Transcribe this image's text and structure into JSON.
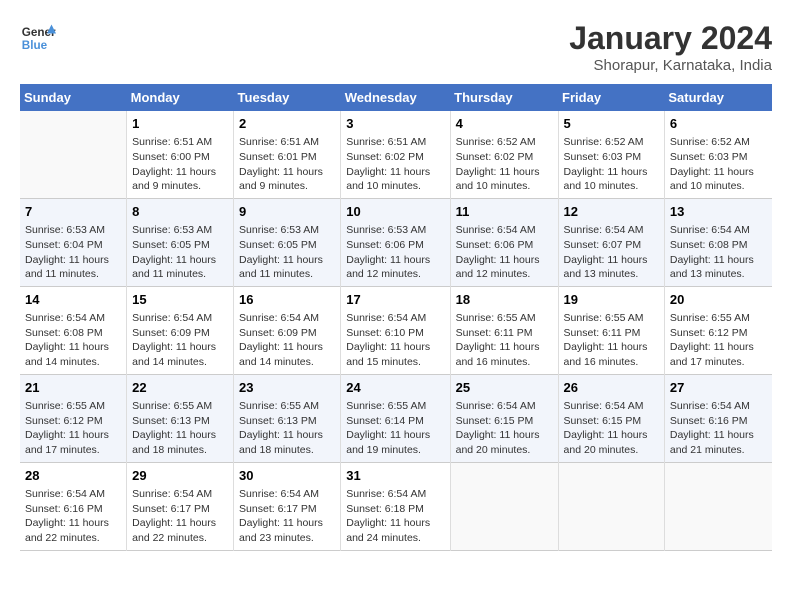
{
  "header": {
    "logo_general": "General",
    "logo_blue": "Blue",
    "month": "January 2024",
    "location": "Shorapur, Karnataka, India"
  },
  "days_of_week": [
    "Sunday",
    "Monday",
    "Tuesday",
    "Wednesday",
    "Thursday",
    "Friday",
    "Saturday"
  ],
  "weeks": [
    [
      {
        "day": "",
        "info": ""
      },
      {
        "day": "1",
        "info": "Sunrise: 6:51 AM\nSunset: 6:00 PM\nDaylight: 11 hours\nand 9 minutes."
      },
      {
        "day": "2",
        "info": "Sunrise: 6:51 AM\nSunset: 6:01 PM\nDaylight: 11 hours\nand 9 minutes."
      },
      {
        "day": "3",
        "info": "Sunrise: 6:51 AM\nSunset: 6:02 PM\nDaylight: 11 hours\nand 10 minutes."
      },
      {
        "day": "4",
        "info": "Sunrise: 6:52 AM\nSunset: 6:02 PM\nDaylight: 11 hours\nand 10 minutes."
      },
      {
        "day": "5",
        "info": "Sunrise: 6:52 AM\nSunset: 6:03 PM\nDaylight: 11 hours\nand 10 minutes."
      },
      {
        "day": "6",
        "info": "Sunrise: 6:52 AM\nSunset: 6:03 PM\nDaylight: 11 hours\nand 10 minutes."
      }
    ],
    [
      {
        "day": "7",
        "info": "Sunrise: 6:53 AM\nSunset: 6:04 PM\nDaylight: 11 hours\nand 11 minutes."
      },
      {
        "day": "8",
        "info": "Sunrise: 6:53 AM\nSunset: 6:05 PM\nDaylight: 11 hours\nand 11 minutes."
      },
      {
        "day": "9",
        "info": "Sunrise: 6:53 AM\nSunset: 6:05 PM\nDaylight: 11 hours\nand 11 minutes."
      },
      {
        "day": "10",
        "info": "Sunrise: 6:53 AM\nSunset: 6:06 PM\nDaylight: 11 hours\nand 12 minutes."
      },
      {
        "day": "11",
        "info": "Sunrise: 6:54 AM\nSunset: 6:06 PM\nDaylight: 11 hours\nand 12 minutes."
      },
      {
        "day": "12",
        "info": "Sunrise: 6:54 AM\nSunset: 6:07 PM\nDaylight: 11 hours\nand 13 minutes."
      },
      {
        "day": "13",
        "info": "Sunrise: 6:54 AM\nSunset: 6:08 PM\nDaylight: 11 hours\nand 13 minutes."
      }
    ],
    [
      {
        "day": "14",
        "info": "Sunrise: 6:54 AM\nSunset: 6:08 PM\nDaylight: 11 hours\nand 14 minutes."
      },
      {
        "day": "15",
        "info": "Sunrise: 6:54 AM\nSunset: 6:09 PM\nDaylight: 11 hours\nand 14 minutes."
      },
      {
        "day": "16",
        "info": "Sunrise: 6:54 AM\nSunset: 6:09 PM\nDaylight: 11 hours\nand 14 minutes."
      },
      {
        "day": "17",
        "info": "Sunrise: 6:54 AM\nSunset: 6:10 PM\nDaylight: 11 hours\nand 15 minutes."
      },
      {
        "day": "18",
        "info": "Sunrise: 6:55 AM\nSunset: 6:11 PM\nDaylight: 11 hours\nand 16 minutes."
      },
      {
        "day": "19",
        "info": "Sunrise: 6:55 AM\nSunset: 6:11 PM\nDaylight: 11 hours\nand 16 minutes."
      },
      {
        "day": "20",
        "info": "Sunrise: 6:55 AM\nSunset: 6:12 PM\nDaylight: 11 hours\nand 17 minutes."
      }
    ],
    [
      {
        "day": "21",
        "info": "Sunrise: 6:55 AM\nSunset: 6:12 PM\nDaylight: 11 hours\nand 17 minutes."
      },
      {
        "day": "22",
        "info": "Sunrise: 6:55 AM\nSunset: 6:13 PM\nDaylight: 11 hours\nand 18 minutes."
      },
      {
        "day": "23",
        "info": "Sunrise: 6:55 AM\nSunset: 6:13 PM\nDaylight: 11 hours\nand 18 minutes."
      },
      {
        "day": "24",
        "info": "Sunrise: 6:55 AM\nSunset: 6:14 PM\nDaylight: 11 hours\nand 19 minutes."
      },
      {
        "day": "25",
        "info": "Sunrise: 6:54 AM\nSunset: 6:15 PM\nDaylight: 11 hours\nand 20 minutes."
      },
      {
        "day": "26",
        "info": "Sunrise: 6:54 AM\nSunset: 6:15 PM\nDaylight: 11 hours\nand 20 minutes."
      },
      {
        "day": "27",
        "info": "Sunrise: 6:54 AM\nSunset: 6:16 PM\nDaylight: 11 hours\nand 21 minutes."
      }
    ],
    [
      {
        "day": "28",
        "info": "Sunrise: 6:54 AM\nSunset: 6:16 PM\nDaylight: 11 hours\nand 22 minutes."
      },
      {
        "day": "29",
        "info": "Sunrise: 6:54 AM\nSunset: 6:17 PM\nDaylight: 11 hours\nand 22 minutes."
      },
      {
        "day": "30",
        "info": "Sunrise: 6:54 AM\nSunset: 6:17 PM\nDaylight: 11 hours\nand 23 minutes."
      },
      {
        "day": "31",
        "info": "Sunrise: 6:54 AM\nSunset: 6:18 PM\nDaylight: 11 hours\nand 24 minutes."
      },
      {
        "day": "",
        "info": ""
      },
      {
        "day": "",
        "info": ""
      },
      {
        "day": "",
        "info": ""
      }
    ]
  ]
}
